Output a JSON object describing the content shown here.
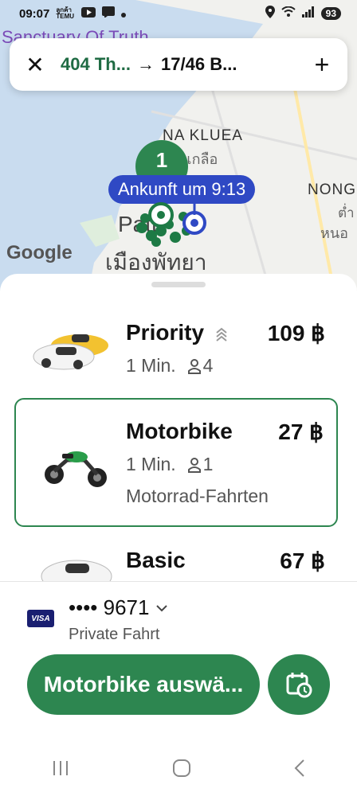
{
  "status_bar": {
    "time": "09:07",
    "app_badge": "ลูกค้า TEMU",
    "battery": "93"
  },
  "map": {
    "place_top": "Sanctuary Of Truth",
    "district_1": "NA KLUEA",
    "district_1_thai": "นาเกลือ",
    "district_2": "NONG",
    "district_2_thai_a": "ต่ำ",
    "district_2_thai_b": "หนอ",
    "city_partial": "Patt",
    "city_thai": "เมืองพัทยา",
    "stop_number": "1",
    "arrival": "Ankunft um 9:13",
    "attribution": "Google"
  },
  "route_bar": {
    "from": "404 Th...",
    "arrow": "→",
    "to": "17/46 B..."
  },
  "ride_options": [
    {
      "name": "Priority",
      "price": "109 ฿",
      "eta": "1 Min.",
      "seats": "4",
      "desc": ""
    },
    {
      "name": "Motorbike",
      "price": "27 ฿",
      "eta": "1 Min.",
      "seats": "1",
      "desc": "Motorrad-Fahrten"
    },
    {
      "name": "Basic",
      "price": "67 ฿",
      "eta": "",
      "seats": "",
      "desc": ""
    }
  ],
  "payment": {
    "card_brand": "VISA",
    "card_number": "•••• 9671",
    "profile": "Private Fahrt"
  },
  "actions": {
    "select_label": "Motorbike auswä..."
  },
  "colors": {
    "brand_green": "#2d8650",
    "arrival_blue": "#2f49c4"
  }
}
